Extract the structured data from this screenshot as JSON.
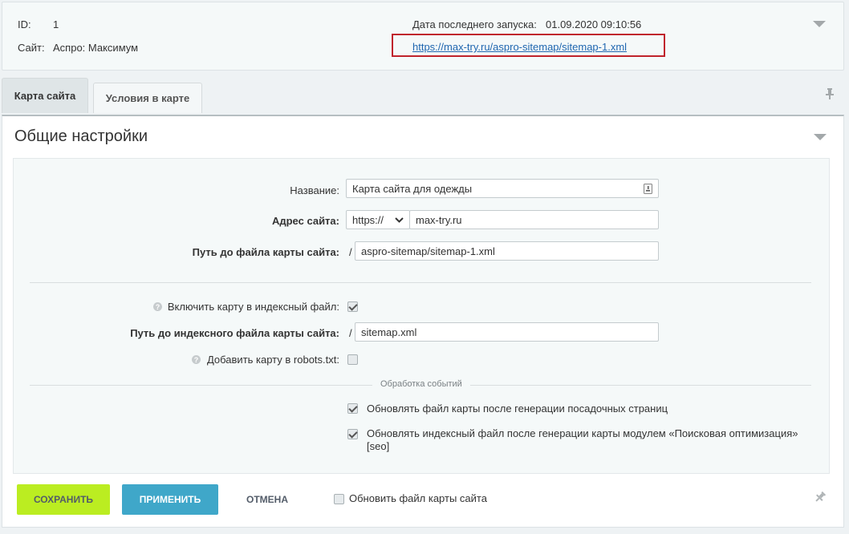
{
  "info": {
    "id_label": "ID:",
    "id_value": "1",
    "site_label": "Сайт:",
    "site_value": "Аспро: Максимум",
    "last_run_label": "Дата последнего запуска:",
    "last_run_value": "01.09.2020 09:10:56",
    "sitemap_link": "https://max-try.ru/aspro-sitemap/sitemap-1.xml"
  },
  "tabs": [
    {
      "label": "Карта сайта"
    },
    {
      "label": "Условия в карте"
    }
  ],
  "panel": {
    "title": "Общие настройки"
  },
  "form": {
    "name_label": "Название:",
    "name_value": "Карта сайта для одежды",
    "address_label": "Адрес сайта:",
    "protocol_value": "https://",
    "domain_value": "max-try.ru",
    "path_label": "Путь до файла карты сайта:",
    "path_slash": "/",
    "path_value": "aspro-sitemap/sitemap-1.xml",
    "index_include_label": "Включить карту в индексный файл:",
    "index_include_checked": true,
    "index_path_label": "Путь до индексного файла карты сайта:",
    "index_path_slash": "/",
    "index_path_value": "sitemap.xml",
    "robots_label": "Добавить карту в robots.txt:",
    "robots_checked": false,
    "events_caption": "Обработка событий",
    "update_after_landing_label": "Обновлять файл карты после генерации посадочных страниц",
    "update_after_landing_checked": true,
    "update_index_label": "Обновлять индексный файл после генерации карты модулем «Поисковая оптимизация» [seo]",
    "update_index_checked": true
  },
  "footer": {
    "save_label": "СОХРАНИТЬ",
    "apply_label": "ПРИМЕНИТЬ",
    "cancel_label": "ОТМЕНА",
    "refresh_label": "Обновить файл карты сайта",
    "refresh_checked": false
  },
  "colors": {
    "save_button": "#bbed21",
    "apply_button": "#3fa7c9",
    "highlight_border": "#c0232c",
    "link": "#2067b0"
  }
}
